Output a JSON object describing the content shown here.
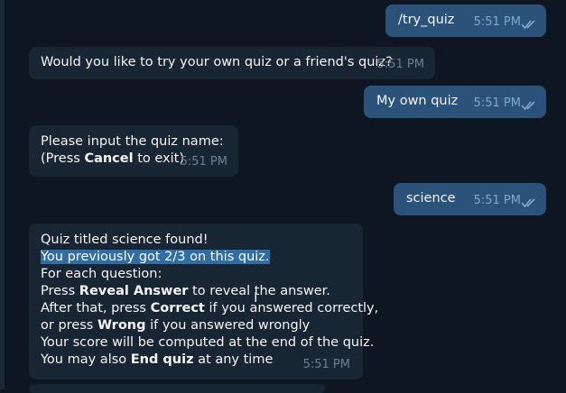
{
  "messages": [
    {
      "text": "/try_quiz",
      "time": "5:51 PM"
    },
    {
      "text": "Would you like to try your own quiz or a friend's quiz?",
      "time": "5:51 PM"
    },
    {
      "text": "My own quiz",
      "time": "5:51 PM"
    },
    {
      "lines": [
        {
          "pre": "Please input the quiz name:"
        },
        {
          "pre": "(Press ",
          "bold": "Cancel",
          "post": " to exit)"
        }
      ],
      "time": "5:51 PM"
    },
    {
      "text": "science",
      "time": "5:51 PM"
    },
    {
      "lines": [
        {
          "pre": "Quiz titled science found!"
        },
        {
          "pre": "You previously got 2/3 on this quiz."
        },
        {
          "pre": "For each question:"
        },
        {
          "pre": "Press ",
          "bold": "Reveal Answer",
          "post": " to reveal the answer."
        },
        {
          "pre": "After that, press ",
          "bold": "Correct",
          "post": " if you answered correctly,"
        },
        {
          "pre": "or press ",
          "bold": "Wrong",
          "post": " if you answered wrongly"
        },
        {
          "pre": "Your score will be computed at the end of the quiz."
        },
        {
          "pre": "You may also ",
          "bold": "End quiz",
          "post": " at any time"
        }
      ],
      "time": "5:51 PM"
    }
  ],
  "colors": {
    "background": "#0e1621",
    "incoming": "#182533",
    "outgoing": "#2b5278",
    "highlight": "#2f6ea5"
  },
  "icons": {
    "read_receipt": "double-check-icon",
    "cursor": "text-cursor-icon"
  }
}
